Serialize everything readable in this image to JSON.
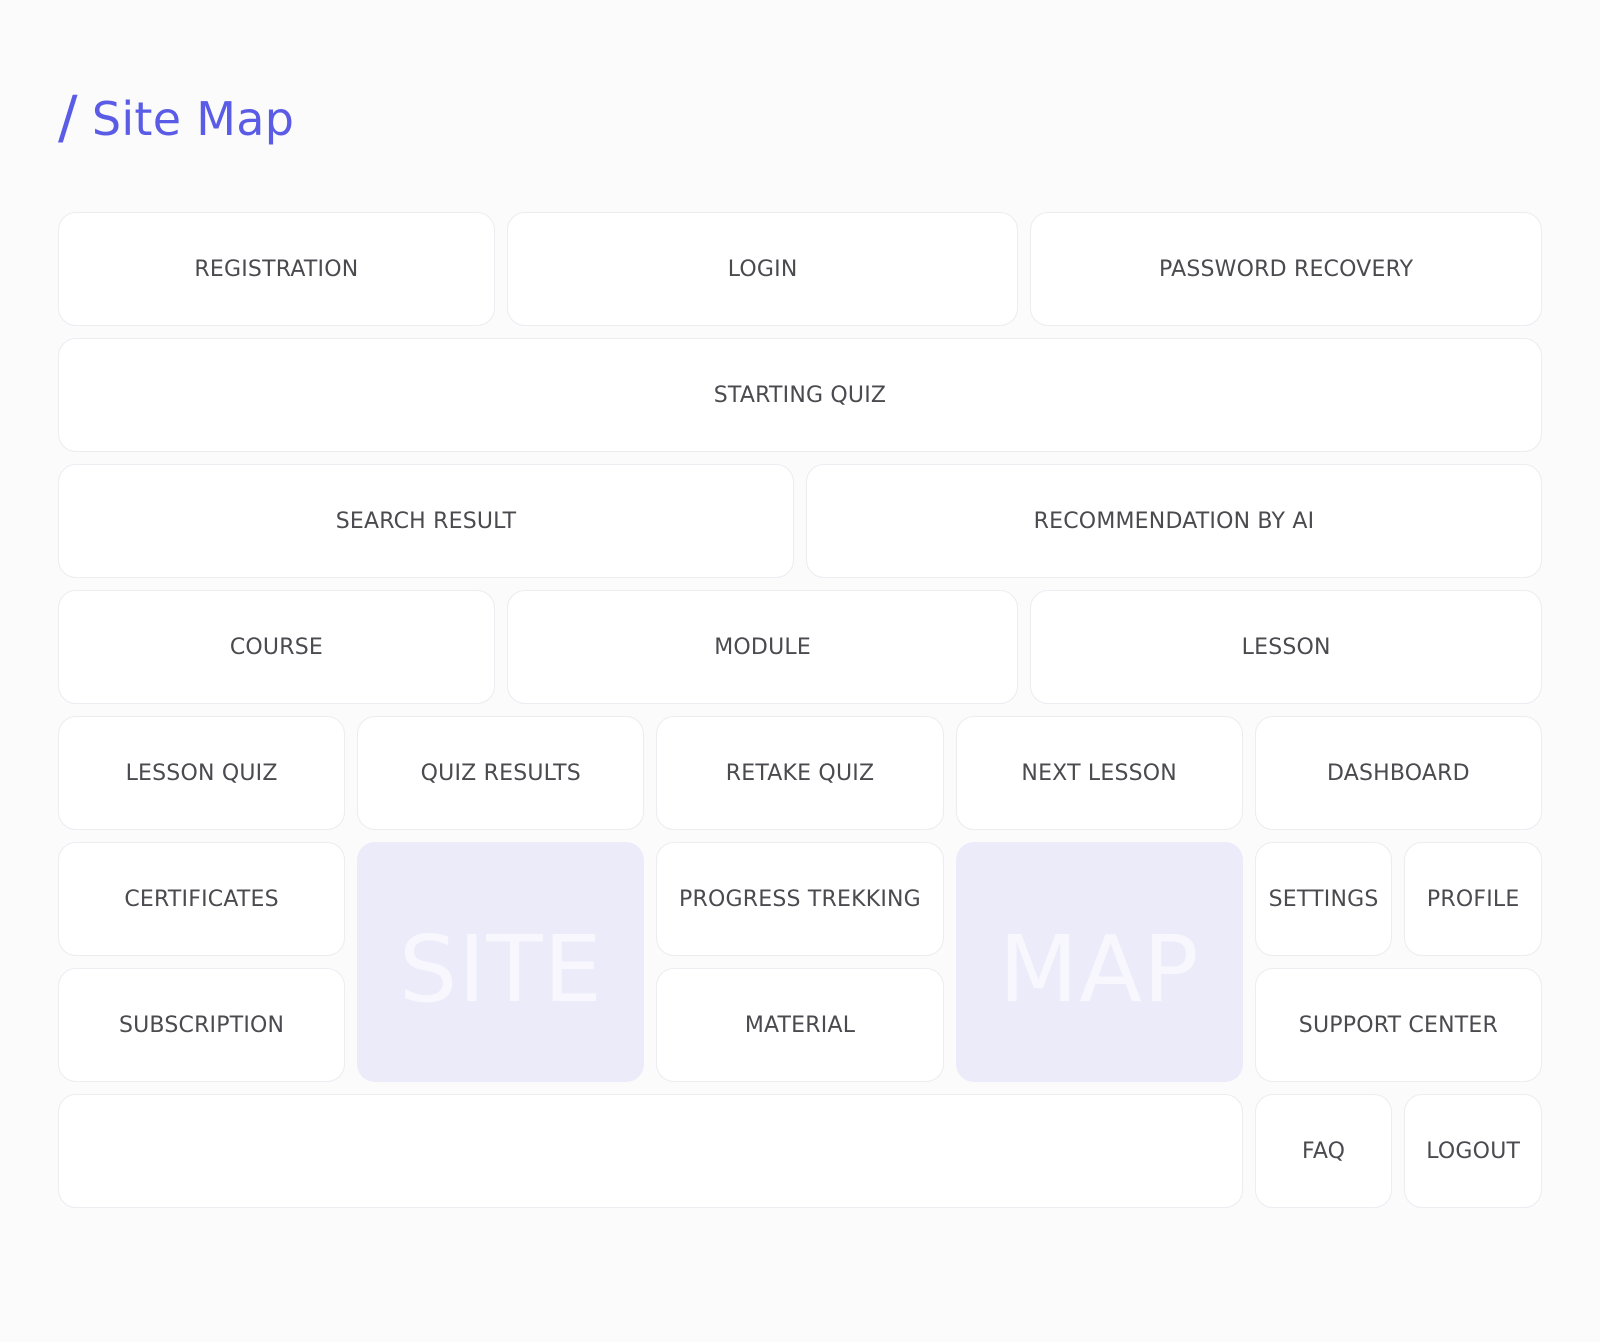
{
  "page": {
    "title_slash": "/",
    "title": "Site Map",
    "accent_color": "#5b5ce6",
    "tile_color": "#ebebfa"
  },
  "nodes": {
    "registration": "REGISTRATION",
    "login": "LOGIN",
    "password_recovery": "PASSWORD RECOVERY",
    "starting_quiz": "STARTING QUIZ",
    "search_result": "SEARCH RESULT",
    "recommendation_by_ai": "RECOMMENDATION BY AI",
    "course": "COURSE",
    "module": "MODULE",
    "lesson": "LESSON",
    "lesson_quiz": "LESSON QUIZ",
    "quiz_results": "QUIZ RESULTS",
    "retake_quiz": "RETAKE QUIZ",
    "next_lesson": "NEXT LESSON",
    "dashboard": "DASHBOARD",
    "certificates": "CERTIFICATES",
    "progress_trekking": "PROGRESS TREKKING",
    "settings": "SETTINGS",
    "profile": "PROFILE",
    "subscription": "SUBSCRIPTION",
    "material": "MATERIAL",
    "support_center": "SUPPORT CENTER",
    "faq": "FAQ",
    "logout": "LOGOUT"
  },
  "decorative": {
    "site": "SITE",
    "map": "MAP"
  }
}
